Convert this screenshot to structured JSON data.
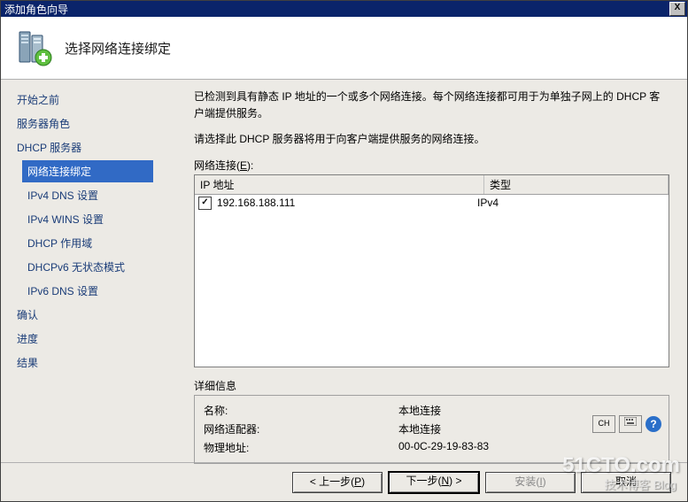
{
  "window": {
    "title": "添加角色向导",
    "close_label": "X"
  },
  "header": {
    "title": "选择网络连接绑定"
  },
  "sidebar": {
    "items": [
      {
        "label": "开始之前",
        "sub": false,
        "selected": false
      },
      {
        "label": "服务器角色",
        "sub": false,
        "selected": false
      },
      {
        "label": "DHCP 服务器",
        "sub": false,
        "selected": false
      },
      {
        "label": "网络连接绑定",
        "sub": true,
        "selected": true
      },
      {
        "label": "IPv4 DNS 设置",
        "sub": true,
        "selected": false
      },
      {
        "label": "IPv4 WINS 设置",
        "sub": true,
        "selected": false
      },
      {
        "label": "DHCP 作用域",
        "sub": true,
        "selected": false
      },
      {
        "label": "DHCPv6 无状态模式",
        "sub": true,
        "selected": false
      },
      {
        "label": "IPv6 DNS 设置",
        "sub": true,
        "selected": false
      },
      {
        "label": "确认",
        "sub": false,
        "selected": false
      },
      {
        "label": "进度",
        "sub": false,
        "selected": false
      },
      {
        "label": "结果",
        "sub": false,
        "selected": false
      }
    ]
  },
  "main": {
    "desc1": "已检测到具有静态 IP 地址的一个或多个网络连接。每个网络连接都可用于为单独子网上的 DHCP 客户端提供服务。",
    "desc2": "请选择此 DHCP 服务器将用于向客户端提供服务的网络连接。",
    "list_label_prefix": "网络连接(",
    "list_label_shortcut": "E",
    "list_label_suffix": "):",
    "columns": {
      "ip": "IP 地址",
      "type": "类型"
    },
    "rows": [
      {
        "checked": true,
        "ip": "192.168.188.111",
        "type": "IPv4"
      }
    ],
    "details_label": "详细信息",
    "details": [
      {
        "k": "名称:",
        "v": "本地连接"
      },
      {
        "k": "网络适配器:",
        "v": "本地连接"
      },
      {
        "k": "物理地址:",
        "v": "00-0C-29-19-83-83"
      }
    ],
    "lang_btn": "CH",
    "help_btn": "?"
  },
  "footer": {
    "prev_pre": "< 上一步(",
    "prev_u": "P",
    "prev_post": ")",
    "next_pre": "下一步(",
    "next_u": "N",
    "next_post": ") >",
    "install_pre": "安装(",
    "install_u": "I",
    "install_post": ")",
    "cancel": "取消"
  },
  "watermark": {
    "line1": "51CTO.com",
    "line2": "技术博客   Blog"
  }
}
